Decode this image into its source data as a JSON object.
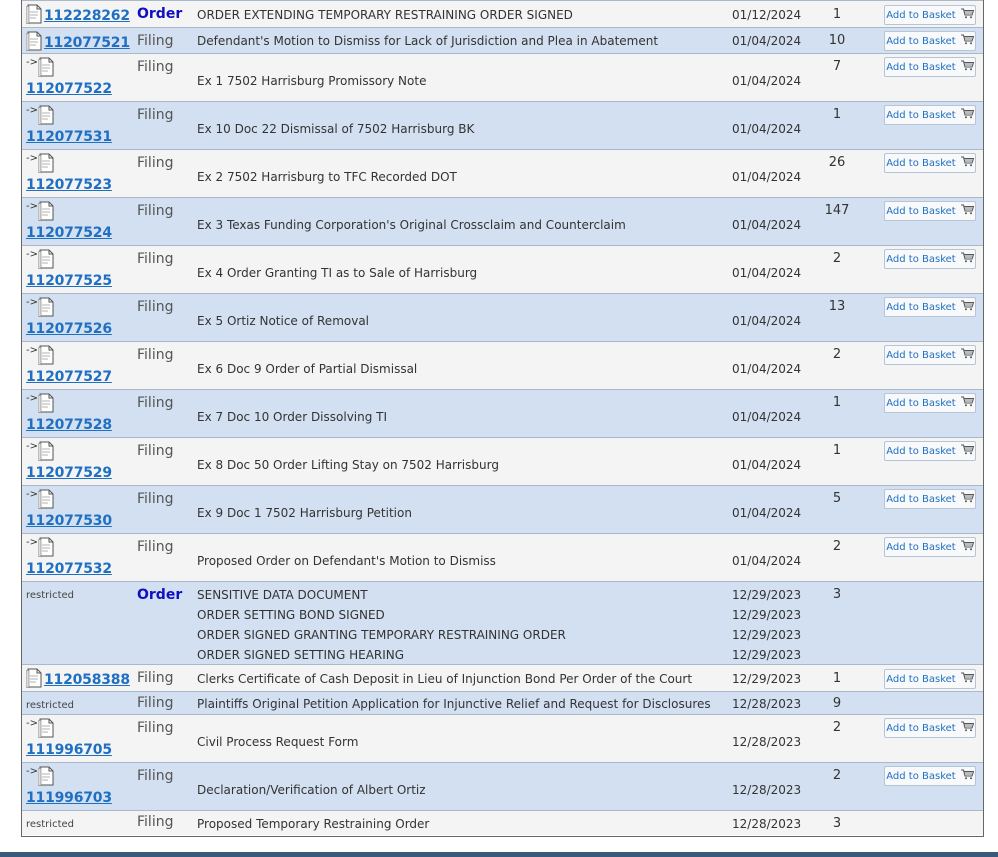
{
  "basket_label": "Add to Basket",
  "restricted_label": "restricted",
  "rows": [
    {
      "image": "112228262",
      "type": "Order",
      "descriptions": [
        "ORDER EXTENDING TEMPORARY RESTRAINING ORDER SIGNED"
      ],
      "dates": [
        "01/12/2024"
      ],
      "pages": "1",
      "basket": true
    },
    {
      "image": "112077521",
      "type": "Filing",
      "descriptions": [
        "Defendant's Motion to Dismiss for Lack of Jurisdiction and Plea in Abatement"
      ],
      "dates": [
        "01/04/2024"
      ],
      "pages": "10",
      "basket": true
    },
    {
      "image": "112077522",
      "arrow": "->",
      "type": "Filing",
      "descriptions": [
        "Ex 1 7502 Harrisburg Promissory Note"
      ],
      "dates": [
        "01/04/2024"
      ],
      "pages": "7",
      "basket": true
    },
    {
      "image": "112077531",
      "arrow": "->",
      "type": "Filing",
      "descriptions": [
        "Ex 10 Doc 22 Dismissal of 7502 Harrisburg BK"
      ],
      "dates": [
        "01/04/2024"
      ],
      "pages": "1",
      "basket": true
    },
    {
      "image": "112077523",
      "arrow": "->",
      "type": "Filing",
      "descriptions": [
        "Ex 2 7502 Harrisburg to TFC Recorded DOT"
      ],
      "dates": [
        "01/04/2024"
      ],
      "pages": "26",
      "basket": true
    },
    {
      "image": "112077524",
      "arrow": "->",
      "type": "Filing",
      "descriptions": [
        "Ex 3 Texas Funding Corporation's Original Crossclaim and Counterclaim"
      ],
      "dates": [
        "01/04/2024"
      ],
      "pages": "147",
      "basket": true
    },
    {
      "image": "112077525",
      "arrow": "->",
      "type": "Filing",
      "descriptions": [
        "Ex 4 Order Granting TI as to Sale of Harrisburg"
      ],
      "dates": [
        "01/04/2024"
      ],
      "pages": "2",
      "basket": true
    },
    {
      "image": "112077526",
      "arrow": "->",
      "type": "Filing",
      "descriptions": [
        "Ex 5 Ortiz Notice of Removal"
      ],
      "dates": [
        "01/04/2024"
      ],
      "pages": "13",
      "basket": true
    },
    {
      "image": "112077527",
      "arrow": "->",
      "type": "Filing",
      "descriptions": [
        "Ex 6 Doc 9 Order of Partial Dismissal"
      ],
      "dates": [
        "01/04/2024"
      ],
      "pages": "2",
      "basket": true
    },
    {
      "image": "112077528",
      "arrow": "->",
      "type": "Filing",
      "descriptions": [
        "Ex 7 Doc 10 Order Dissolving TI"
      ],
      "dates": [
        "01/04/2024"
      ],
      "pages": "1",
      "basket": true
    },
    {
      "image": "112077529",
      "arrow": "->",
      "type": "Filing",
      "descriptions": [
        "Ex 8 Doc 50 Order Lifting Stay on 7502 Harrisburg"
      ],
      "dates": [
        "01/04/2024"
      ],
      "pages": "1",
      "basket": true
    },
    {
      "image": "112077530",
      "arrow": "->",
      "type": "Filing",
      "descriptions": [
        "Ex 9 Doc 1 7502 Harrisburg Petition"
      ],
      "dates": [
        "01/04/2024"
      ],
      "pages": "5",
      "basket": true
    },
    {
      "image": "112077532",
      "arrow": "->",
      "type": "Filing",
      "descriptions": [
        "Proposed Order on Defendant's Motion to Dismiss"
      ],
      "dates": [
        "01/04/2024"
      ],
      "pages": "2",
      "basket": true
    },
    {
      "restricted": true,
      "type": "Order",
      "descriptions": [
        "SENSITIVE DATA DOCUMENT",
        "ORDER SETTING BOND SIGNED",
        "ORDER SIGNED GRANTING TEMPORARY RESTRAINING ORDER",
        "ORDER SIGNED SETTING HEARING"
      ],
      "dates": [
        "12/29/2023",
        "12/29/2023",
        "12/29/2023",
        "12/29/2023"
      ],
      "pages": "3",
      "basket": false
    },
    {
      "image": "112058388",
      "type": "Filing",
      "descriptions": [
        "Clerks Certificate of Cash Deposit in Lieu of Injunction Bond Per Order of the Court"
      ],
      "dates": [
        "12/29/2023"
      ],
      "pages": "1",
      "basket": true
    },
    {
      "restricted": true,
      "type": "Filing",
      "descriptions": [
        "Plaintiffs Original Petition Application for Injunctive Relief and Request for Disclosures"
      ],
      "dates": [
        "12/28/2023"
      ],
      "pages": "9",
      "basket": false
    },
    {
      "image": "111996705",
      "arrow": "->",
      "type": "Filing",
      "descriptions": [
        "Civil Process Request Form"
      ],
      "dates": [
        "12/28/2023"
      ],
      "pages": "2",
      "basket": true
    },
    {
      "image": "111996703",
      "arrow": "->",
      "type": "Filing",
      "descriptions": [
        "Declaration/Verification of Albert Ortiz"
      ],
      "dates": [
        "12/28/2023"
      ],
      "pages": "2",
      "basket": true
    },
    {
      "restricted": true,
      "type": "Filing",
      "descriptions": [
        "Proposed Temporary Restraining Order"
      ],
      "dates": [
        "12/28/2023"
      ],
      "pages": "3",
      "basket": false
    }
  ]
}
